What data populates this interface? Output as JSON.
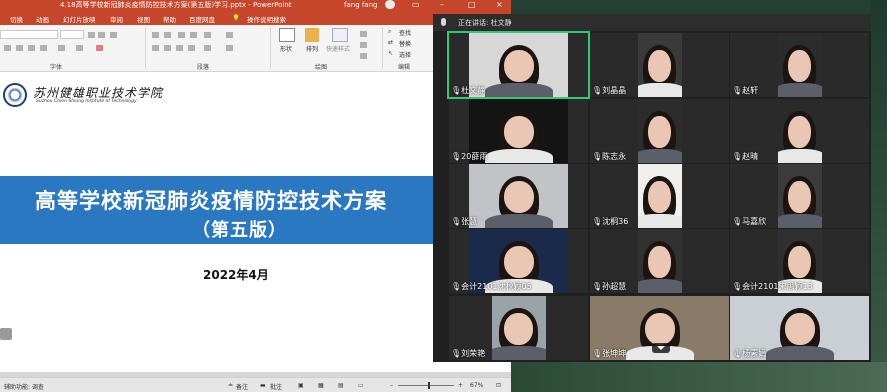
{
  "ppt": {
    "doc_title": "4.18高等学校新冠肺炎疫情防控技术方案(第五版)学习.pptx  -  PowerPoint",
    "user": "fang fang",
    "tabs": [
      "切换",
      "动画",
      "幻灯片放映",
      "审阅",
      "视图",
      "帮助",
      "百度网盘",
      "操作说明搜索"
    ],
    "ribbon": {
      "groups": [
        "字体",
        "段落",
        "绘图",
        "编辑"
      ],
      "shape_label": "形状",
      "arrange_label": "排列",
      "quickstyle_label": "快速样式",
      "find_label": "查找",
      "replace_label": "替换",
      "select_label": "选择"
    },
    "slide": {
      "logo_cn": "苏州健雄职业技术学院",
      "logo_en": "Suzhou Chien-Shiung Institute of Technology",
      "title": "高等学校新冠肺炎疫情防控技术方案",
      "subtitle": "（第五版）",
      "date": "2022年4月"
    },
    "status": {
      "accessibility": "辅助功能: 调查",
      "notes": "备注",
      "comments": "批注",
      "zoom": "67%"
    }
  },
  "meeting": {
    "speaking_label": "正在讲话: 杜文静",
    "participants": [
      "杜文静",
      "刘晶晶",
      "赵轩",
      "20薛雨",
      "陈志永",
      "赵晴",
      "张慧",
      "沈桐36",
      "马嘉欣",
      "会计2101沈秋颖05",
      "孙超慧",
      "会计2101宋思颖13",
      "刘荣艳",
      "张坤坤",
      "杨素娟"
    ]
  },
  "colors": {
    "ppt_accent": "#c5462b",
    "slide_banner": "#2a77c2",
    "active_speaker_border": "#2ecc71"
  }
}
